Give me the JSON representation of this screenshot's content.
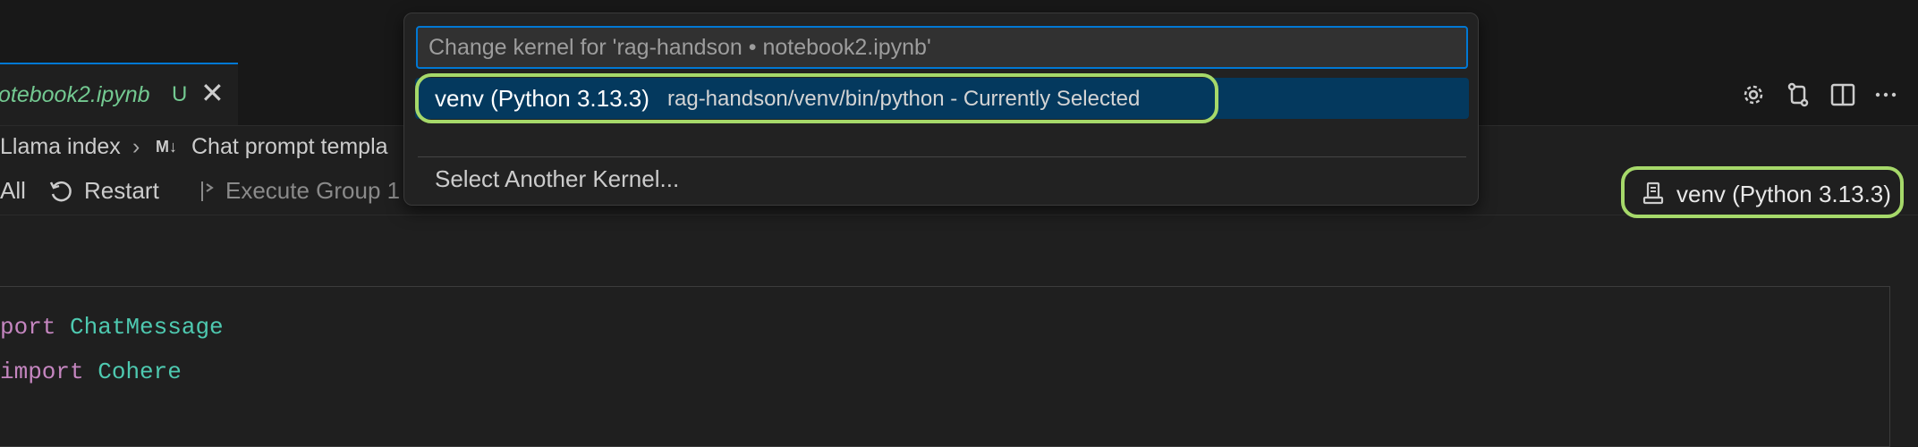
{
  "tab": {
    "label": "otebook2.ipynb",
    "status": "U",
    "close": "✕"
  },
  "breadcrumb": {
    "item1": "Llama index",
    "separator": "›",
    "md_icon": "M↓",
    "item2": "Chat prompt templa"
  },
  "toolbar": {
    "run_all": "All",
    "restart": "Restart",
    "execute_group": "Execute Group 1"
  },
  "kernel_button": {
    "label": "venv (Python 3.13.3)"
  },
  "code_lines": [
    {
      "keyword": "port",
      "name": "ChatMessage"
    },
    {
      "keyword": "import",
      "name": "Cohere"
    }
  ],
  "quick_pick": {
    "placeholder": "Change kernel for 'rag-handson • notebook2.ipynb'",
    "selected_item": {
      "name": "venv (Python 3.13.3)",
      "description": "rag-handson/venv/bin/python - Currently Selected"
    },
    "other_item": "Select Another Kernel..."
  },
  "colors": {
    "accent": "#0078d4",
    "highlight_ring": "#a6d96a",
    "selection": "#04395e",
    "untracked": "#73c991"
  }
}
